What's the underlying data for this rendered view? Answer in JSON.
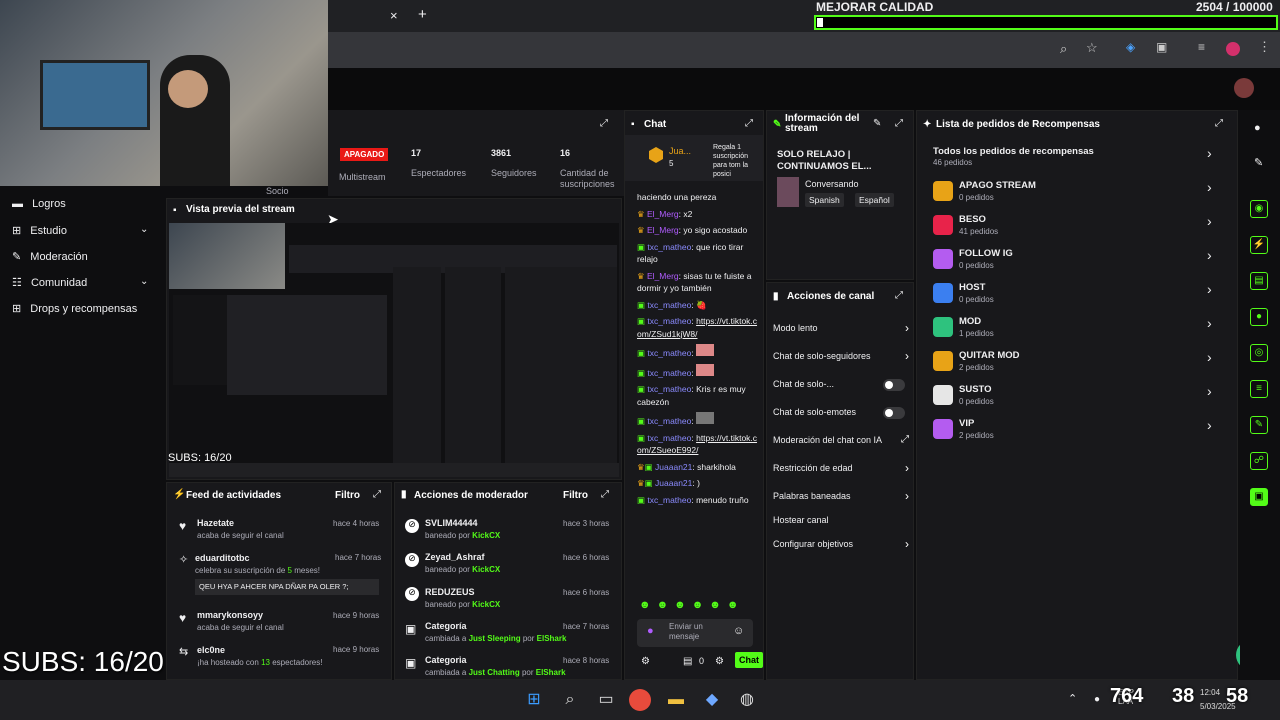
{
  "browser": {
    "tab_close": "×",
    "tab_new": "+",
    "quality_label": "MEJORAR CALIDAD",
    "quality_count": "2504 / 100000"
  },
  "stats": {
    "status": "APAGADO",
    "multistream": "Multistream",
    "viewers_value": "17",
    "viewers_label": "Espectadores",
    "followers_value": "3861",
    "followers_label": "Seguidores",
    "subs_value": "16",
    "subs_label": "Cantidad de suscripciones"
  },
  "sidebar": {
    "partner": "Socio",
    "items": [
      {
        "label": "Logros"
      },
      {
        "label": "Estudio"
      },
      {
        "label": "Moderación"
      },
      {
        "label": "Comunidad"
      },
      {
        "label": "Drops y recompensas"
      }
    ]
  },
  "preview": {
    "title": "Vista previa del stream",
    "overlay": "SUBS: 16/20"
  },
  "overlay_big": "SUBS: 16/20",
  "activity": {
    "title": "Feed de actividades",
    "filter": "Filtro",
    "items": [
      {
        "user": "Hazetate",
        "time": "hace 4 horas",
        "desc": "acaba de seguir el canal"
      },
      {
        "user": "eduarditotbc",
        "time": "hace 7 horas",
        "desc_pre": "celebra su suscripción de",
        "desc_num": "5",
        "desc_post": "meses!",
        "message": "QEU HYA P AHCER NPA DÑAR PA OLER ?;"
      },
      {
        "user": "mmarykonsoyy",
        "time": "hace 9 horas",
        "desc": "acaba de seguir el canal"
      },
      {
        "user": "elc0ne",
        "time": "hace 9 horas",
        "desc_pre": "¡ha hosteado con",
        "desc_num": "13",
        "desc_post": "espectadores!"
      }
    ]
  },
  "modactions": {
    "title": "Acciones de moderador",
    "filter": "Filtro",
    "items": [
      {
        "user": "SVLIM44444",
        "time": "hace 3 horas",
        "action": "baneado por",
        "by": "KickCX"
      },
      {
        "user": "Zeyad_Ashraf",
        "time": "hace 6 horas",
        "action": "baneado por",
        "by": "KickCX"
      },
      {
        "user": "REDUZEUS",
        "time": "hace 6 horas",
        "action": "baneado por",
        "by": "KickCX"
      },
      {
        "user": "Categoría",
        "time": "hace 7 horas",
        "action": "cambiada a",
        "value": "Just Sleeping",
        "by_pre": "por",
        "by": "ElShark"
      },
      {
        "user": "Categoria",
        "time": "hace 8 horas",
        "action": "cambiada a",
        "value": "Just Chatting",
        "by_pre": "por",
        "by": "ElShark"
      }
    ]
  },
  "chat": {
    "title": "Chat",
    "gift_user": "Jua...",
    "gift_count": "5",
    "gift_text": "Regala 1 suscripción para tom la posici",
    "messages": [
      {
        "user": "",
        "text": "haciendo una pereza"
      },
      {
        "user": "El_Merg",
        "text": "x2"
      },
      {
        "user": "El_Merg",
        "text": "yo sigo acostado"
      },
      {
        "user": "txc_matheo",
        "text": "que rico tirar relajo"
      },
      {
        "user": "El_Merg",
        "text": "sisas tu te fuiste a dormir y yo también"
      },
      {
        "user": "txc_matheo",
        "text": ""
      },
      {
        "user": "txc_matheo",
        "text": "https://vt.tiktok.com/ZSud1kjW8/"
      },
      {
        "user": "txc_matheo",
        "text": ""
      },
      {
        "user": "txc_matheo",
        "text": ""
      },
      {
        "user": "txc_matheo",
        "text": "Kris r es muy cabezón"
      },
      {
        "user": "txc_matheo",
        "text": ""
      },
      {
        "user": "txc_matheo",
        "text": "https://vt.tiktok.com/ZSueoE992/"
      },
      {
        "user": "Juaaan21",
        "text": "sharkihola"
      },
      {
        "user": "Juaaan21",
        "text": ")"
      },
      {
        "user": "txc_matheo",
        "text": "menudo truño"
      }
    ],
    "input_placeholder": "Enviar un mensaje",
    "footer_count": "0",
    "send": "Chat",
    "colors": {
      "mod": "#53fc18",
      "user": "#8b8bff",
      "merg": "#b05cff"
    }
  },
  "info": {
    "title": "Información del stream",
    "stream_title": "SOLO RELAJO | CONTINUAMOS EL...",
    "category": "Conversando",
    "tags": [
      "Spanish",
      "Español"
    ]
  },
  "channel_actions": {
    "title": "Acciones de canal",
    "items": [
      {
        "label": "Modo lento"
      },
      {
        "label": "Chat de solo-seguidores"
      },
      {
        "label": "Chat de solo-..."
      },
      {
        "label": "Chat de solo-emotes"
      },
      {
        "label": "Moderación del chat con IA"
      },
      {
        "label": "Restricción de edad"
      },
      {
        "label": "Palabras baneadas"
      },
      {
        "label": "Hostear canal"
      },
      {
        "label": "Configurar objetivos"
      }
    ]
  },
  "rewards": {
    "title": "Lista de pedidos de Recompensas",
    "all_label": "Todos los pedidos de recompensas",
    "all_count": "46 pedidos",
    "items": [
      {
        "name": "APAGO STREAM",
        "count": "0 pedidos",
        "color": "#e8a317"
      },
      {
        "name": "BESO",
        "count": "41 pedidos",
        "color": "#e8234a"
      },
      {
        "name": "FOLLOW IG",
        "count": "0 pedidos",
        "color": "#b45cf0"
      },
      {
        "name": "HOST",
        "count": "0 pedidos",
        "color": "#3b7ff0"
      },
      {
        "name": "MOD",
        "count": "1 pedidos",
        "color": "#2ec27e"
      },
      {
        "name": "QUITAR MOD",
        "count": "2 pedidos",
        "color": "#e8a317"
      },
      {
        "name": "SUSTO",
        "count": "0 pedidos",
        "color": "#e6e6e6"
      },
      {
        "name": "VIP",
        "count": "2 pedidos",
        "color": "#b45cf0"
      }
    ]
  },
  "taskbar": {
    "time": "12:04",
    "date": "5/03/2025",
    "lang": "ESP LAA",
    "clock_overlay": "764",
    "clock_overlay2": "38",
    "clock_overlay3": "58"
  }
}
